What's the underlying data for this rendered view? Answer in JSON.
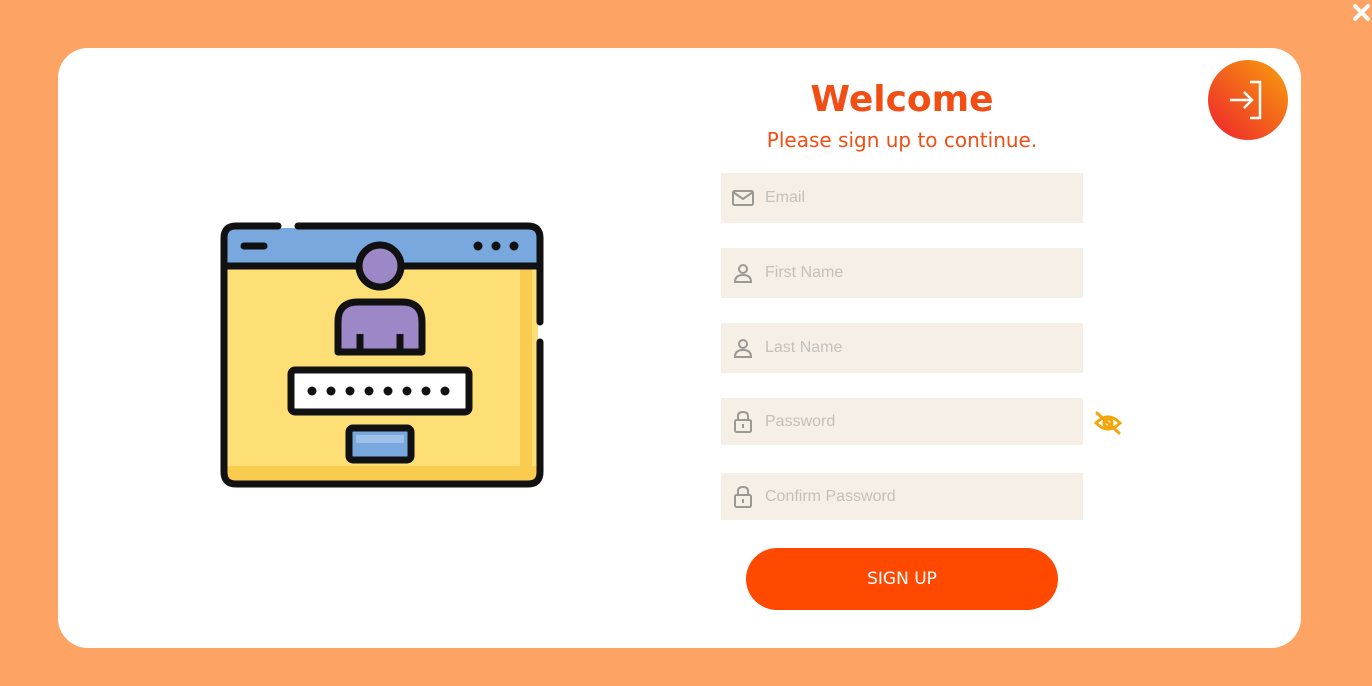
{
  "window": {
    "close_icon": "close-icon"
  },
  "header": {
    "title": "Welcome",
    "subtitle": "Please sign up to continue.",
    "switch_icon": "sign-in-icon"
  },
  "illustration": {
    "icon": "browser-login-illustration"
  },
  "form": {
    "fields": [
      {
        "icon": "envelope-icon",
        "placeholder": "Email",
        "value": ""
      },
      {
        "icon": "user-icon",
        "placeholder": "First Name",
        "value": ""
      },
      {
        "icon": "user-icon",
        "placeholder": "Last Name",
        "value": ""
      },
      {
        "icon": "lock-icon",
        "placeholder": "Password",
        "value": ""
      },
      {
        "icon": "lock-icon",
        "placeholder": "Confirm Password",
        "value": ""
      }
    ],
    "password_toggle_icon": "eye-slash-icon",
    "submit_label": "SIGN UP"
  },
  "colors": {
    "background": "#fda363",
    "accent": "#f24e14",
    "button": "#ff4800",
    "field_bg": "#f5efe6",
    "placeholder": "#c3c0bb"
  }
}
